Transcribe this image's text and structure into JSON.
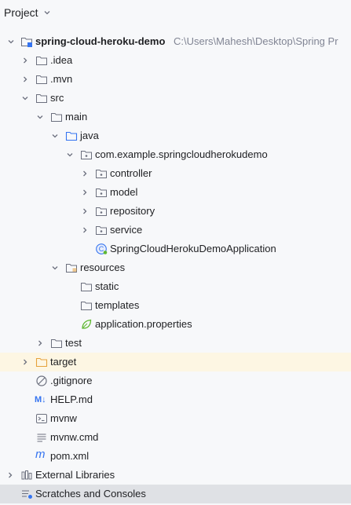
{
  "panel": {
    "title": "Project"
  },
  "tree": {
    "root": {
      "label": "spring-cloud-heroku-demo",
      "path": "C:\\Users\\Mahesh\\Desktop\\Spring Pr"
    },
    "idea": "› .idea",
    "idea_label": ".idea",
    "mvn": ".mvn",
    "src": "src",
    "main": "main",
    "java": "java",
    "package": "com.example.springcloudherokudemo",
    "controller": "controller",
    "model": "model",
    "repository": "repository",
    "service": "service",
    "app_class": "SpringCloudHerokuDemoApplication",
    "resources": "resources",
    "static": "static",
    "templates": "templates",
    "app_props": "application.properties",
    "test": "test",
    "target": "target",
    "gitignore": ".gitignore",
    "help_md": "HELP.md",
    "help_md_badge": "M↓",
    "mvnw": "mvnw",
    "mvnw_cmd": "mvnw.cmd",
    "pom": "pom.xml",
    "external_libraries": "External Libraries",
    "scratches": "Scratches and Consoles"
  },
  "colors": {
    "folder_stroke": "#6c707e",
    "source_folder": "#3574f0",
    "target_folder": "#e6a23c",
    "spring_green": "#5fb832",
    "selected_row": "#dfe1e5",
    "excluded_row": "#fdf6e3"
  }
}
